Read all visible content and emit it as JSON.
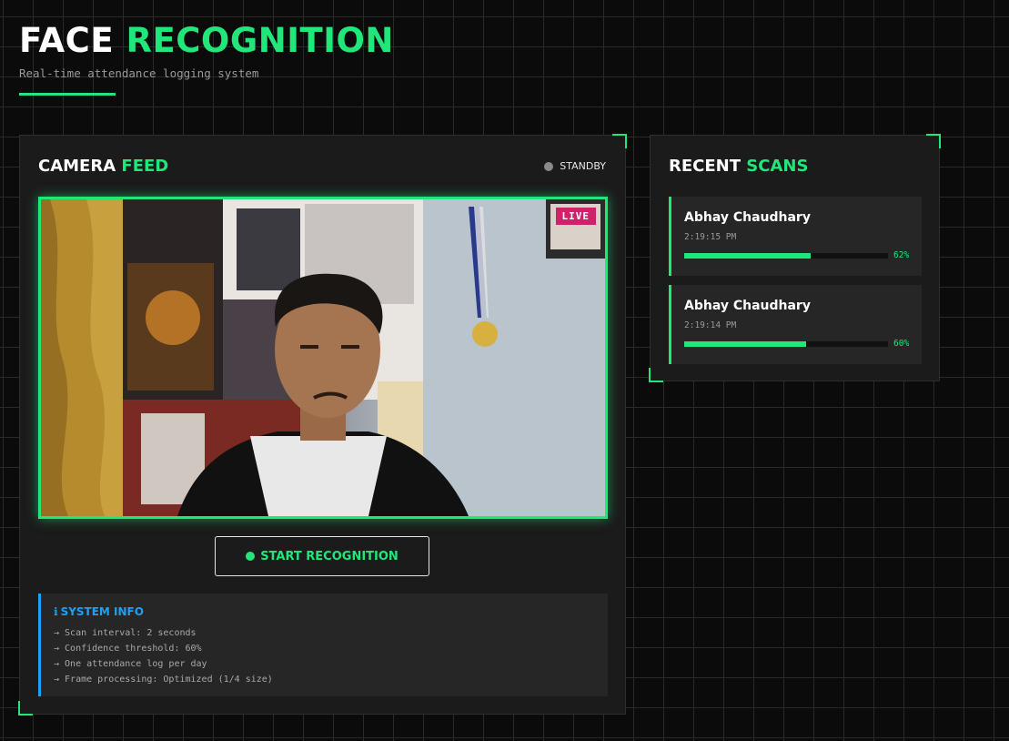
{
  "header": {
    "title_word1": "FACE",
    "title_word2": "RECOGNITION",
    "subtitle": "Real-time attendance logging system"
  },
  "camera": {
    "title_word1": "CAMERA",
    "title_word2": "FEED",
    "status": "STANDBY",
    "live_badge": "LIVE",
    "start_button": "START RECOGNITION"
  },
  "system_info": {
    "title": "SYSTEM INFO",
    "icon": "info-icon",
    "lines": [
      "→ Scan interval: 2 seconds",
      "→ Confidence threshold: 60%",
      "→ One attendance log per day",
      "→ Frame processing: Optimized (1/4 size)"
    ]
  },
  "recent_scans": {
    "title_word1": "RECENT",
    "title_word2": "SCANS",
    "items": [
      {
        "name": "Abhay Chaudhary",
        "time": "2:19:15 PM",
        "confidence": 62,
        "confidence_label": "62%"
      },
      {
        "name": "Abhay Chaudhary",
        "time": "2:19:14 PM",
        "confidence": 60,
        "confidence_label": "60%"
      }
    ]
  },
  "colors": {
    "accent": "#1fe77a",
    "info": "#1da1f2",
    "live": "#d0226a",
    "background": "#0b0b0b",
    "panel": "#1b1b1b"
  }
}
